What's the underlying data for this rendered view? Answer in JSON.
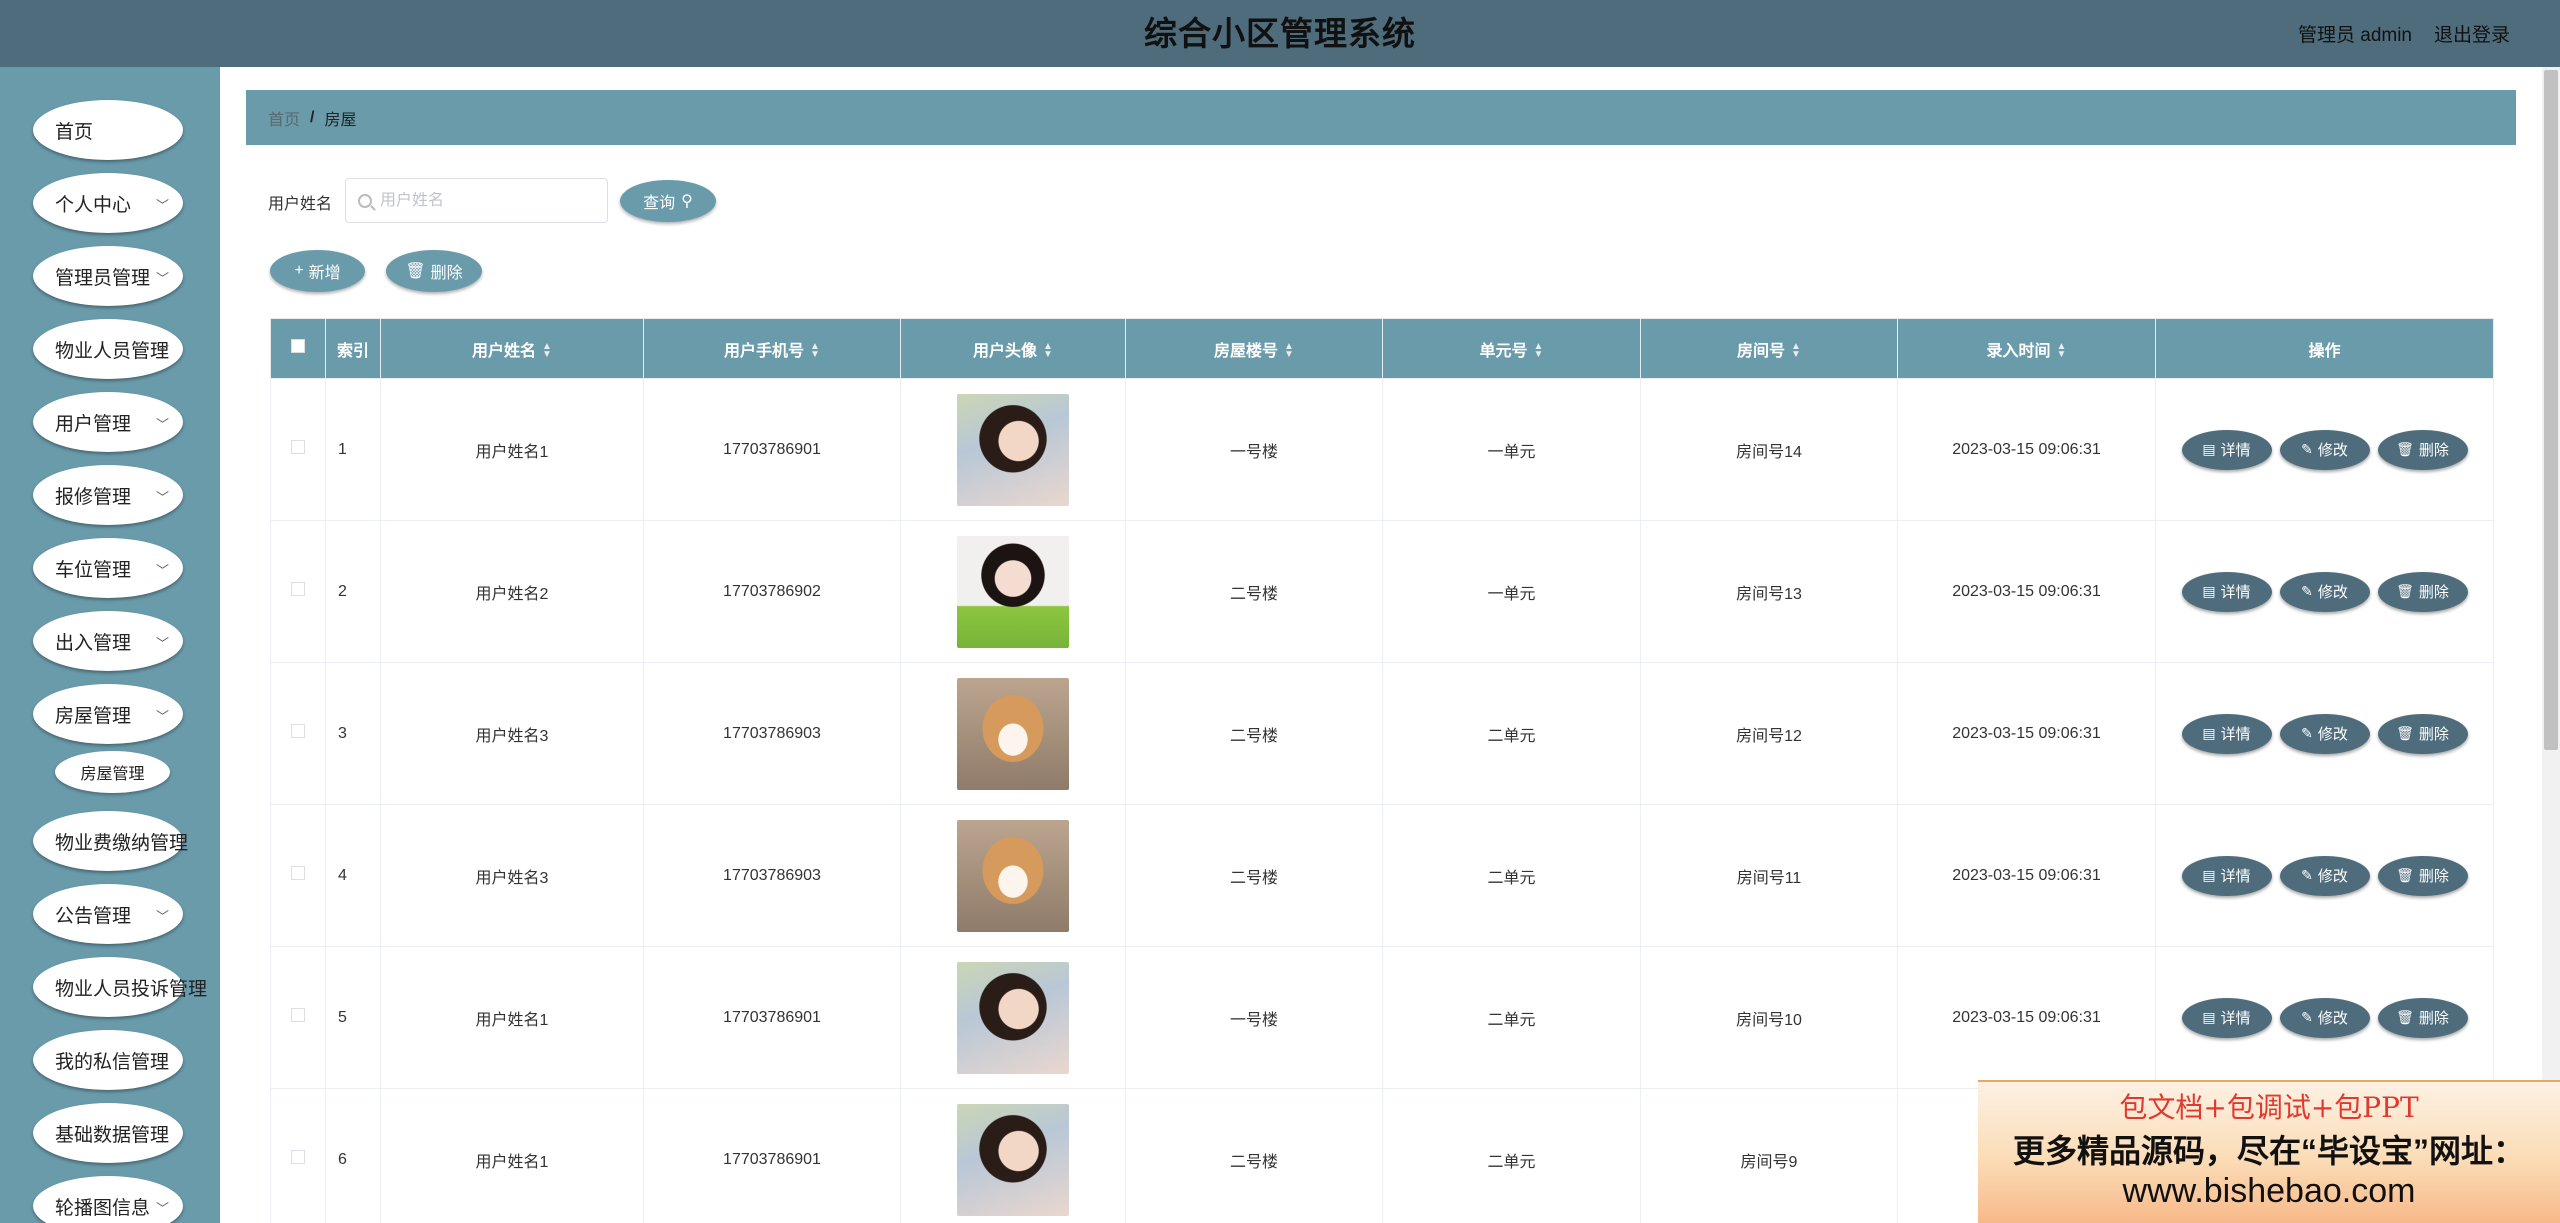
{
  "header": {
    "title": "综合小区管理系统",
    "user": "管理员 admin",
    "logout": "退出登录"
  },
  "sidebar": {
    "items": [
      {
        "label": "首页",
        "chevron": false
      },
      {
        "label": "个人中心",
        "chevron": true
      },
      {
        "label": "管理员管理",
        "chevron": true
      },
      {
        "label": "物业人员管理",
        "chevron": true
      },
      {
        "label": "用户管理",
        "chevron": true
      },
      {
        "label": "报修管理",
        "chevron": true
      },
      {
        "label": "车位管理",
        "chevron": true
      },
      {
        "label": "出入管理",
        "chevron": true
      },
      {
        "label": "房屋管理",
        "chevron": true
      },
      {
        "label": "物业费缴纳管理",
        "chevron": false
      },
      {
        "label": "公告管理",
        "chevron": true
      },
      {
        "label": "物业人员投诉管理",
        "chevron": false
      },
      {
        "label": "我的私信管理",
        "chevron": false
      },
      {
        "label": "基础数据管理",
        "chevron": false
      },
      {
        "label": "轮播图信息",
        "chevron": true
      }
    ],
    "submenu": {
      "label": "房屋管理"
    }
  },
  "breadcrumb": {
    "home": "首页",
    "sep": "/",
    "current": "房屋"
  },
  "search": {
    "label": "用户姓名",
    "placeholder": "用户姓名",
    "button": "查询"
  },
  "toolbar": {
    "add": "新增",
    "delete": "删除"
  },
  "table": {
    "headers": [
      "索引",
      "用户姓名",
      "用户手机号",
      "用户头像",
      "房屋楼号",
      "单元号",
      "房间号",
      "录入时间",
      "操作"
    ],
    "rows": [
      {
        "idx": "1",
        "name": "用户姓名1",
        "phone": "17703786901",
        "avatar": "girl",
        "building": "一号楼",
        "unit": "一单元",
        "room": "房间号14",
        "time": "2023-03-15 09:06:31"
      },
      {
        "idx": "2",
        "name": "用户姓名2",
        "phone": "17703786902",
        "avatar": "green",
        "building": "二号楼",
        "unit": "一单元",
        "room": "房间号13",
        "time": "2023-03-15 09:06:31"
      },
      {
        "idx": "3",
        "name": "用户姓名3",
        "phone": "17703786903",
        "avatar": "dog",
        "building": "二号楼",
        "unit": "二单元",
        "room": "房间号12",
        "time": "2023-03-15 09:06:31"
      },
      {
        "idx": "4",
        "name": "用户姓名3",
        "phone": "17703786903",
        "avatar": "dog",
        "building": "二号楼",
        "unit": "二单元",
        "room": "房间号11",
        "time": "2023-03-15 09:06:31"
      },
      {
        "idx": "5",
        "name": "用户姓名1",
        "phone": "17703786901",
        "avatar": "girl",
        "building": "一号楼",
        "unit": "二单元",
        "room": "房间号10",
        "time": "2023-03-15 09:06:31"
      },
      {
        "idx": "6",
        "name": "用户姓名1",
        "phone": "17703786901",
        "avatar": "girl",
        "building": "二号楼",
        "unit": "二单元",
        "room": "房间号9",
        "time": "202"
      }
    ],
    "actions": {
      "detail": "详情",
      "edit": "修改",
      "delete": "删除"
    }
  },
  "ad": {
    "line1": "包文档+包调试+包PPT",
    "line2": "更多精品源码，尽在“毕设宝”网址：",
    "line3": "www.bishebao.com"
  },
  "colors": {
    "header": "#4e6c7b",
    "sidebar": "#6a9bab",
    "button": "#6a9bab",
    "action": "#4e6c7b"
  }
}
